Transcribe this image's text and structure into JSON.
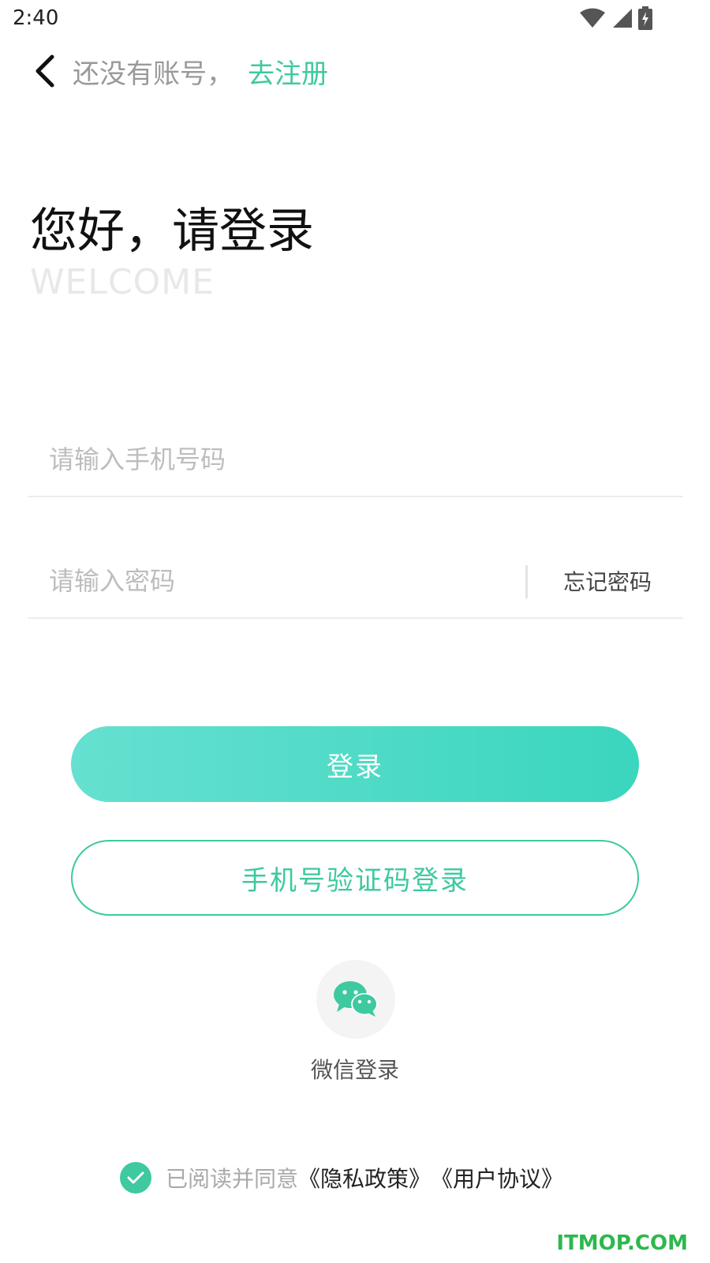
{
  "status_bar": {
    "time": "2:40",
    "icons": [
      "wifi-icon",
      "signal-icon",
      "battery-charging-icon"
    ]
  },
  "nav": {
    "prompt": "还没有账号，",
    "register_link": "去注册"
  },
  "greeting": {
    "title": "您好，请登录",
    "subtitle": "WELCOME"
  },
  "form": {
    "phone": {
      "value": "",
      "placeholder": "请输入手机号码"
    },
    "password": {
      "value": "",
      "placeholder": "请输入密码"
    },
    "forgot_label": "忘记密码"
  },
  "buttons": {
    "login_label": "登录",
    "sms_login_label": "手机号验证码登录"
  },
  "social": {
    "wechat_label": "微信登录",
    "icon": "wechat-icon"
  },
  "agreement": {
    "checked": true,
    "prefix": "已阅读并同意",
    "privacy_link": "《隐私政策》",
    "user_link": "《用户协议》"
  },
  "watermark": "ITMOP.COM",
  "colors": {
    "accent": "#3ec9a0",
    "gradient_start": "#66e0d0",
    "gradient_end": "#3ad6bd"
  }
}
